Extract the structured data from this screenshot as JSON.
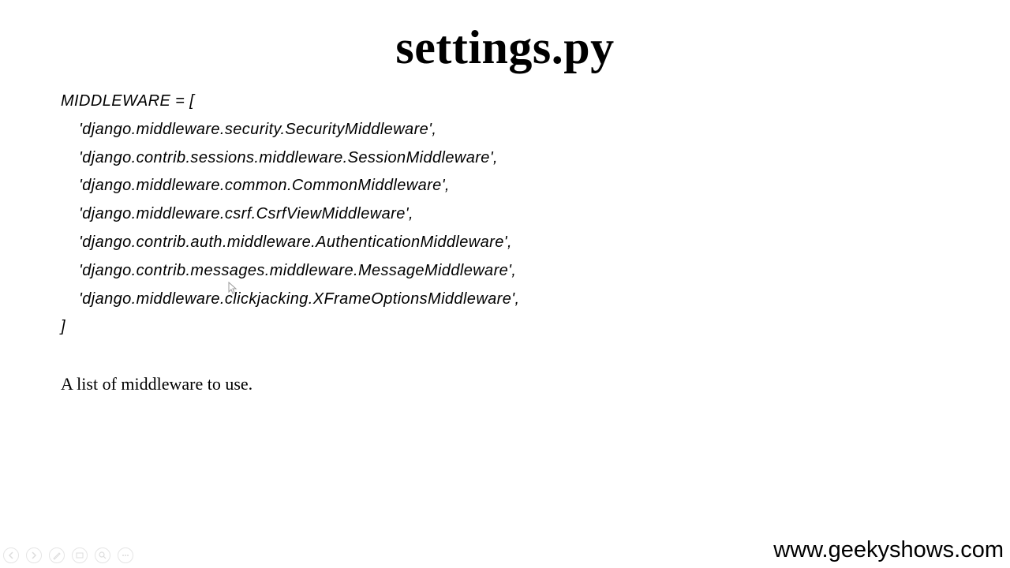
{
  "slide": {
    "title": "settings.py",
    "code": {
      "open": "MIDDLEWARE = [",
      "items": [
        "'django.middleware.security.SecurityMiddleware',",
        "'django.contrib.sessions.middleware.SessionMiddleware',",
        "'django.middleware.common.CommonMiddleware',",
        "'django.middleware.csrf.CsrfViewMiddleware',",
        "'django.contrib.auth.middleware.AuthenticationMiddleware',",
        "'django.contrib.messages.middleware.MessageMiddleware',",
        "'django.middleware.clickjacking.XFrameOptionsMiddleware',"
      ],
      "close": "]"
    },
    "description": "A list of middleware to use.",
    "footer": "www.geekyshows.com"
  },
  "controls": {
    "icons": [
      "previous-icon",
      "next-icon",
      "pen-icon",
      "slides-icon",
      "zoom-icon",
      "more-icon"
    ]
  }
}
